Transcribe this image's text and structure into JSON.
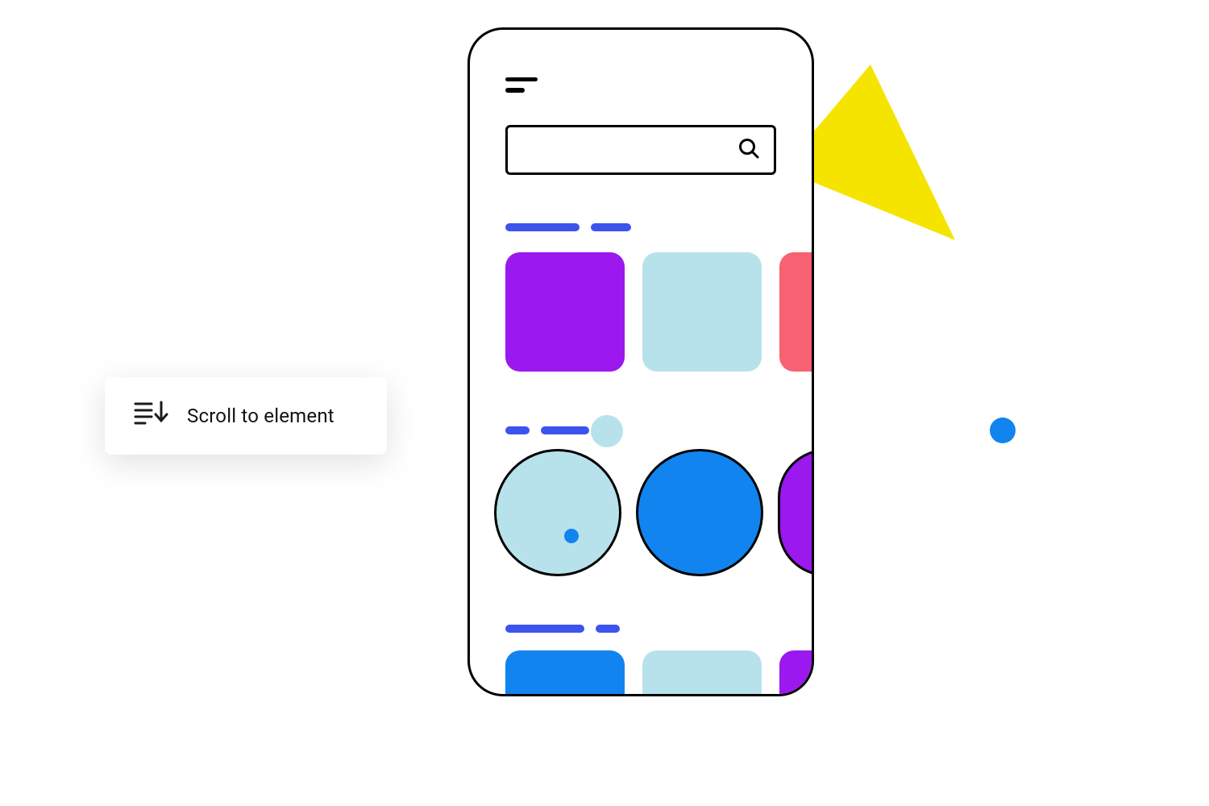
{
  "action_card": {
    "label": "Scroll to element",
    "icon": "scroll-to-element-icon"
  },
  "phone": {
    "hamburger": "menu-icon",
    "search": {
      "icon": "search-icon",
      "placeholder": ""
    },
    "sections": [
      {
        "header_segments": 2,
        "items": [
          {
            "shape": "square",
            "color": "#9b18ef"
          },
          {
            "shape": "square",
            "color": "#b7e2ec"
          },
          {
            "shape": "square",
            "color": "#f76272"
          }
        ]
      },
      {
        "header_segments": 2,
        "items": [
          {
            "shape": "circle",
            "color": "#b7e2ec",
            "dot": "#1184ef"
          },
          {
            "shape": "circle",
            "color": "#1184ef"
          },
          {
            "shape": "circle",
            "color": "#9b18ef"
          }
        ]
      },
      {
        "header_segments": 2,
        "items": [
          {
            "shape": "square",
            "color": "#1184ef"
          },
          {
            "shape": "square",
            "color": "#b7e2ec"
          },
          {
            "shape": "square",
            "color": "#9b18ef"
          }
        ]
      }
    ]
  },
  "decorations": {
    "triangle_purple": "#8b20e6",
    "triangle_yellow": "#f5e400",
    "dot_blue": "#1184ef"
  }
}
